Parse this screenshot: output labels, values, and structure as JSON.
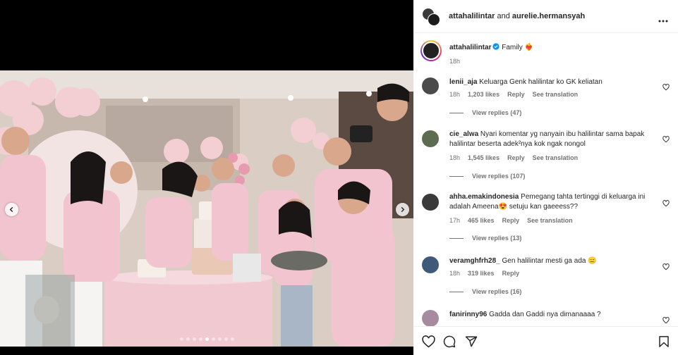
{
  "header": {
    "user1": "attahalilintar",
    "joiner": " and ",
    "user2": "aurelie.hermansyah"
  },
  "caption": {
    "username": "attahalilintar",
    "text": " Family ",
    "emoji": "❤️‍🔥",
    "time": "18h"
  },
  "comments": [
    {
      "username": "lenii_aja",
      "text": " Keluarga Genk halilintar ko GK keliatan",
      "time": "18h",
      "likes": "1,203 likes",
      "reply": "Reply",
      "translate": "See translation",
      "view_replies": "View replies (47)",
      "avatar_color": "#4a4a4a"
    },
    {
      "username": "cie_alwa",
      "text": " Nyari komentar yg nanyain ibu halilintar sama bapak halilintar beserta adek²nya kok ngak nongol",
      "time": "18h",
      "likes": "1,545 likes",
      "reply": "Reply",
      "translate": "See translation",
      "view_replies": "View replies (107)",
      "avatar_color": "#5d6b4e"
    },
    {
      "username": "ahha.emakindonesia",
      "text": " Pemegang tahta tertinggi di keluarga ini adalah Ameena",
      "text2": " setuju kan gaeeess??",
      "emoji": "😍",
      "time": "17h",
      "likes": "465 likes",
      "reply": "Reply",
      "translate": "See translation",
      "view_replies": "View replies (13)",
      "avatar_color": "#3a3a3a"
    },
    {
      "username": "veramghfrh28_",
      "text": " Gen halilintar mesti ga ada ",
      "emoji": "😑",
      "time": "18h",
      "likes": "319 likes",
      "reply": "Reply",
      "view_replies": "View replies (16)",
      "avatar_color": "#3f5a78"
    },
    {
      "username": "fanirinny96",
      "text": " Gadda dan Gaddi nya dimanaaaa ?",
      "avatar_color": "#a58aa0"
    }
  ],
  "colors": {
    "verified": "#0095f6",
    "meta_text": "#737373",
    "text": "#262626"
  },
  "icons": [
    "heart-icon",
    "comment-icon",
    "share-icon",
    "bookmark-icon",
    "more-icon",
    "chevron-left-icon",
    "chevron-right-icon"
  ],
  "carousel": {
    "slides": 9,
    "active": 5
  }
}
